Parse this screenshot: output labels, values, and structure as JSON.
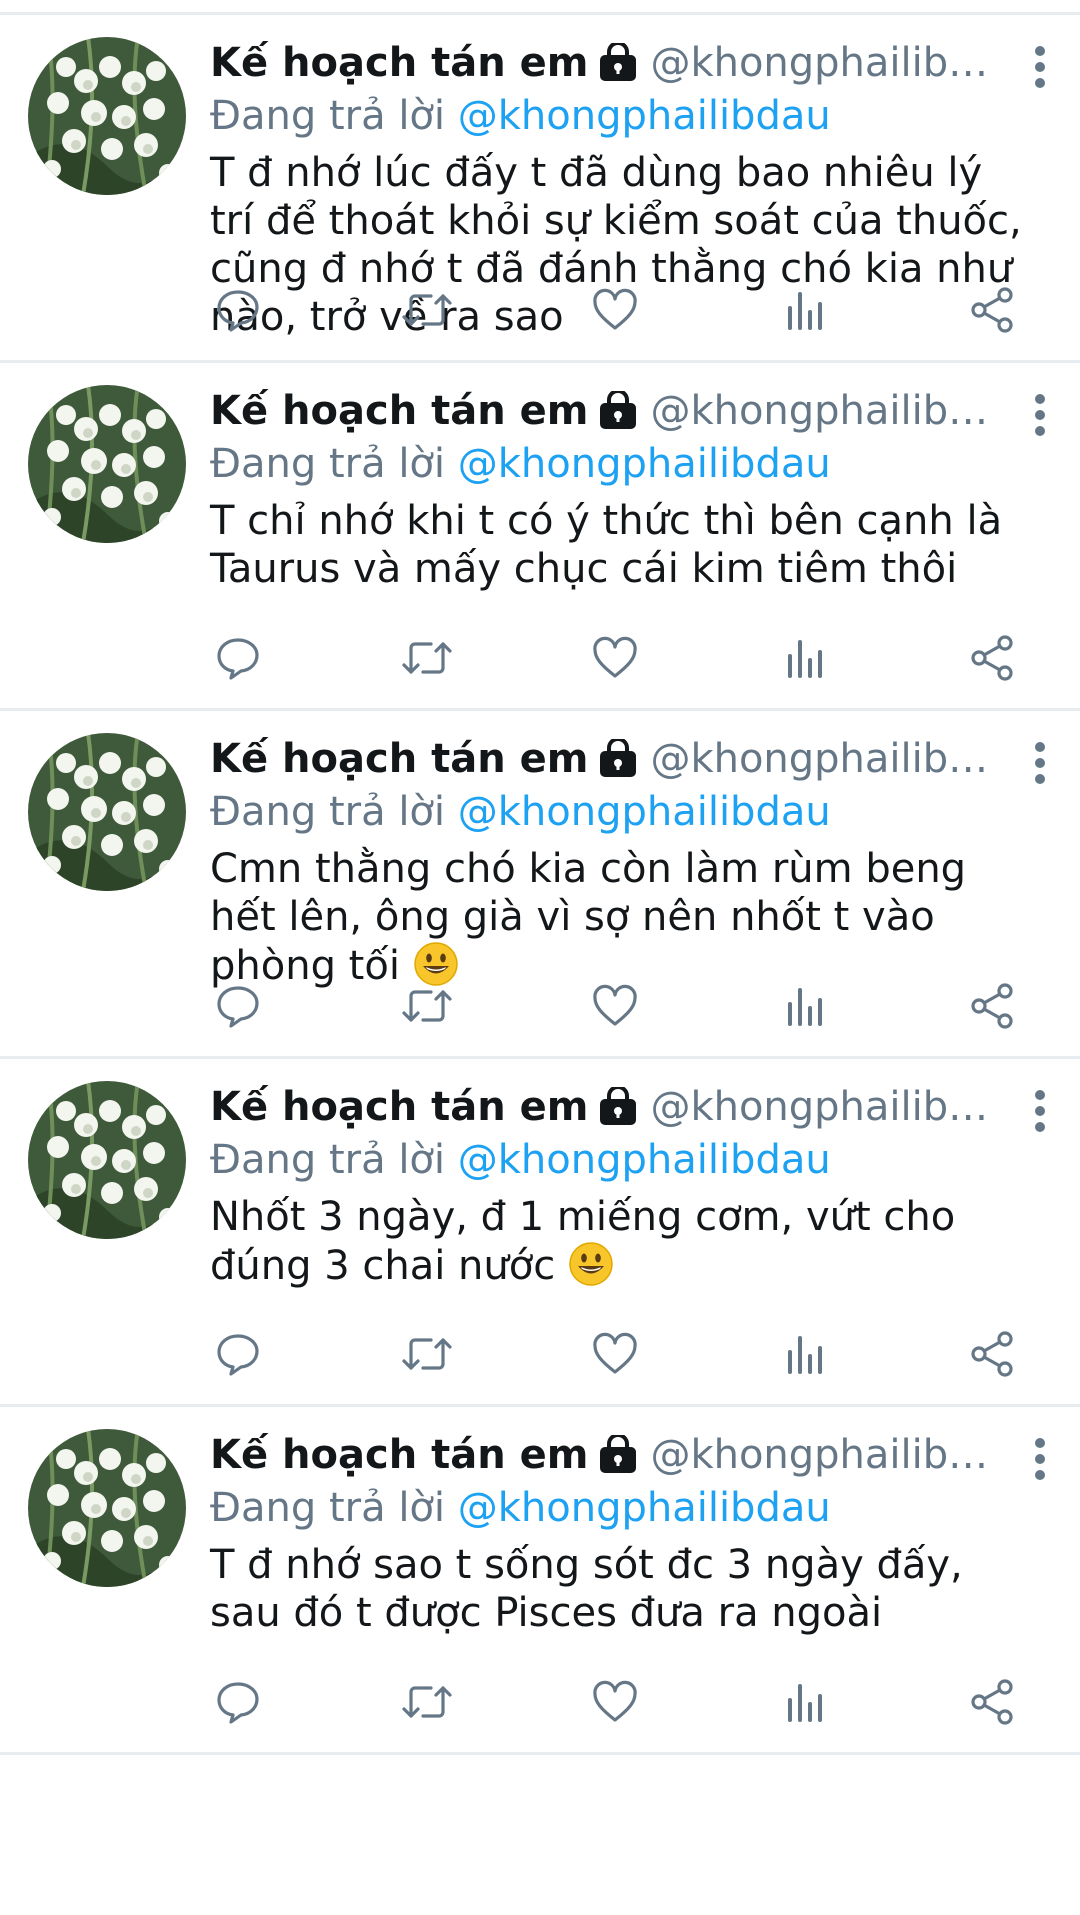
{
  "colors": {
    "name": "#14171a",
    "muted": "#657786",
    "link": "#1da1f2",
    "divider": "#e6ecf0"
  },
  "tweets": [
    {
      "name": "Kế hoạch tán em",
      "handle": "@khongphailibd…",
      "reply_prefix": "Đang trả lời ",
      "reply_to": "@khongphailibdau",
      "text": "T đ nhớ lúc đấy t đã dùng bao nhiêu lý trí để thoát khỏi sự kiểm soát của thuốc, cũng đ nhớ t đã đánh thằng chó kia như nào, trở về ra sao",
      "emoji": ""
    },
    {
      "name": "Kế hoạch tán em",
      "handle": "@khongphailibd…",
      "reply_prefix": "Đang trả lời ",
      "reply_to": "@khongphailibdau",
      "text": "T chỉ nhớ khi t có ý thức thì bên cạnh là Taurus và mấy chục cái kim tiêm thôi",
      "emoji": ""
    },
    {
      "name": "Kế hoạch tán em",
      "handle": "@khongphailibd…",
      "reply_prefix": "Đang trả lời ",
      "reply_to": "@khongphailibdau",
      "text": "Cmn thằng chó kia còn làm rùm beng hết lên, ông già vì sợ nên nhốt t vào phòng tối ",
      "emoji": "grinning-face"
    },
    {
      "name": "Kế hoạch tán em",
      "handle": "@khongphailibd…",
      "reply_prefix": "Đang trả lời ",
      "reply_to": "@khongphailibdau",
      "text": "Nhốt 3 ngày, đ 1 miếng cơm, vứt cho đúng 3 chai nước ",
      "emoji": "grinning-face"
    },
    {
      "name": "Kế hoạch tán em",
      "handle": "@khongphailibd…",
      "reply_prefix": "Đang trả lời ",
      "reply_to": "@khongphailibdau",
      "text": "T đ nhớ sao t sống sót đc 3 ngày đấy, sau đó t được Pisces đưa ra ngoài",
      "emoji": ""
    }
  ],
  "icons": {
    "lock": "lock-icon",
    "more": "more-vertical-icon",
    "reply": "reply-icon",
    "retweet": "retweet-icon",
    "like": "heart-icon",
    "analytics": "analytics-icon",
    "share": "share-icon"
  }
}
